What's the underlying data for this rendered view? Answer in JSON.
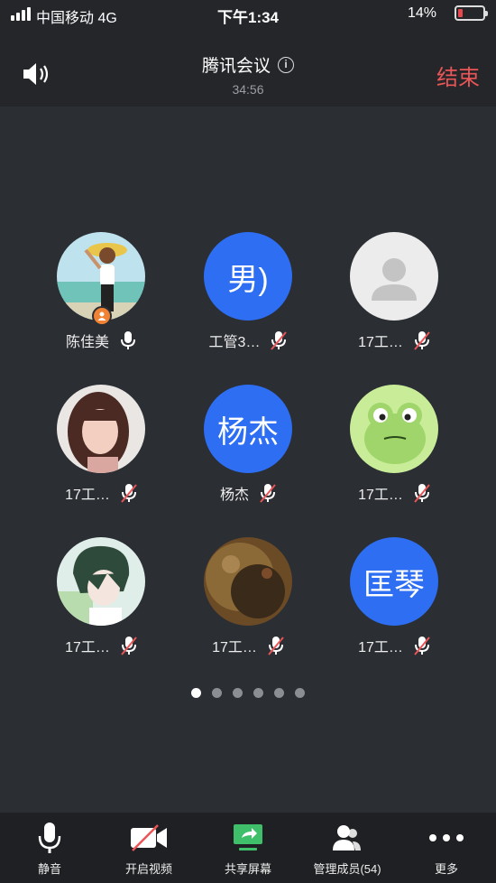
{
  "status": {
    "carrier": "中国移动  4G",
    "time": "下午1:34",
    "battery": "14%"
  },
  "header": {
    "title": "腾讯会议",
    "timer": "34:56",
    "end_label": "结束"
  },
  "participants": [
    {
      "name": "陈佳美",
      "avatar_text": "",
      "mic": "on"
    },
    {
      "name": "工管3…",
      "avatar_text": "男)",
      "mic": "muted"
    },
    {
      "name": "17工…",
      "avatar_text": "",
      "mic": "muted"
    },
    {
      "name": "17工…",
      "avatar_text": "",
      "mic": "muted"
    },
    {
      "name": "杨杰",
      "avatar_text": "杨杰",
      "mic": "muted"
    },
    {
      "name": "17工…",
      "avatar_text": "",
      "mic": "muted"
    },
    {
      "name": "17工…",
      "avatar_text": "",
      "mic": "muted"
    },
    {
      "name": "17工…",
      "avatar_text": "",
      "mic": "muted"
    },
    {
      "name": "17工…",
      "avatar_text": "匡琴",
      "mic": "muted"
    }
  ],
  "pager": {
    "pages": 6,
    "current": 1
  },
  "toolbar": {
    "mute": "静音",
    "video": "开启视频",
    "share": "共享屏幕",
    "members": "管理成员(54)",
    "more": "更多"
  },
  "colors": {
    "accent": "#2d6ef2",
    "end": "#ea5557",
    "share": "#3fbf6a",
    "host": "#f08233"
  }
}
